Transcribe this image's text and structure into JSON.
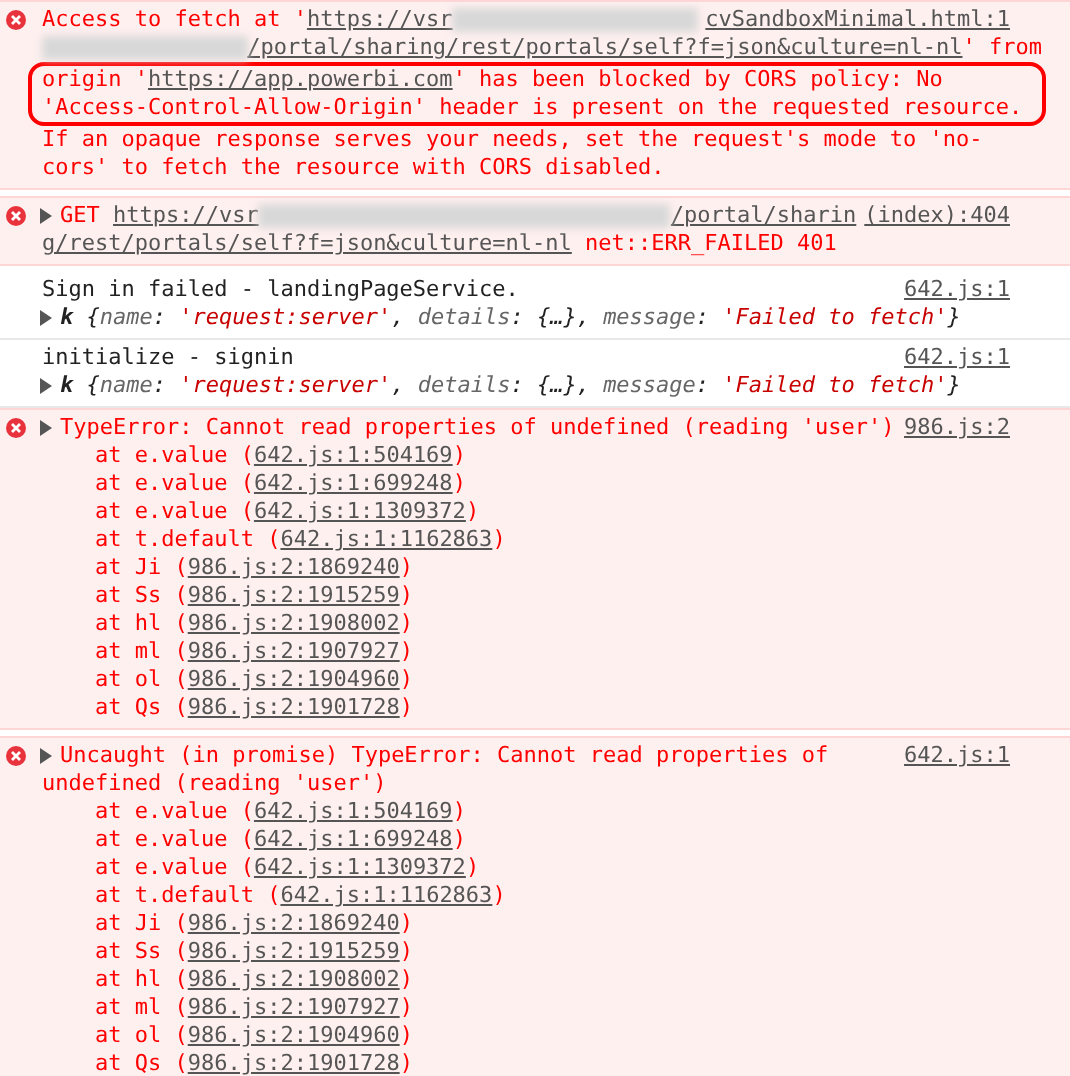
{
  "messages": [
    {
      "kind": "error",
      "source": "cvSandboxMinimal.html:1",
      "lines": [
        {
          "circled": false,
          "segments": [
            {
              "kind": "plain",
              "text": "Access to fetch at '"
            },
            {
              "kind": "link",
              "text": "https://vsr"
            },
            {
              "kind": "redacted"
            }
          ]
        },
        {
          "circled": false,
          "segments": [
            {
              "kind": "redacted"
            },
            {
              "kind": "link",
              "text": "/portal/sharing/rest/portals/self?f=json&culture=nl-nl"
            },
            {
              "kind": "plain",
              "text": "' from"
            }
          ]
        },
        {
          "circled": true,
          "segments": [
            {
              "kind": "plain",
              "text": "origin '"
            },
            {
              "kind": "link",
              "text": "https://app.powerbi.com"
            },
            {
              "kind": "plain",
              "text": "' has been blocked by CORS policy: No"
            }
          ]
        },
        {
          "circled": true,
          "segments": [
            {
              "kind": "plain",
              "text": "'Access-Control-Allow-Origin' header is present on the requested resource."
            }
          ]
        },
        {
          "circled": false,
          "segments": [
            {
              "kind": "plain",
              "text": "If an opaque response serves your needs, set the request's mode to 'no-"
            }
          ]
        },
        {
          "circled": false,
          "segments": [
            {
              "kind": "plain",
              "text": "cors' to fetch the resource with CORS disabled."
            }
          ]
        }
      ]
    },
    {
      "kind": "error",
      "source": "(index):404",
      "lines": [
        {
          "circled": false,
          "expanded": false,
          "segments": [
            {
              "kind": "plain",
              "text": "GET "
            },
            {
              "kind": "link",
              "text": "https://vsr"
            },
            {
              "kind": "redacted"
            },
            {
              "kind": "link",
              "text": "/portal/sharin"
            }
          ]
        },
        {
          "circled": false,
          "segments": [
            {
              "kind": "link",
              "text": "g/rest/portals/self?f=json&culture=nl-nl"
            },
            {
              "kind": "plain",
              "text": " net::ERR_FAILED 401"
            }
          ]
        }
      ]
    },
    {
      "kind": "log",
      "source": "642.js:1",
      "lines": [
        {
          "circled": false,
          "segments": [
            {
              "kind": "plain",
              "text": "Sign in failed - landingPageService."
            }
          ]
        },
        {
          "circled": false,
          "expanded": false,
          "segments": [
            {
              "kind": "class",
              "text": "k"
            },
            {
              "kind": "punct",
              "text": " {"
            },
            {
              "kind": "key",
              "text": "name"
            },
            {
              "kind": "punct",
              "text": ": "
            },
            {
              "kind": "string",
              "text": "'request:server'"
            },
            {
              "kind": "punct",
              "text": ", "
            },
            {
              "kind": "key",
              "text": "details"
            },
            {
              "kind": "punct",
              "text": ": {…}, "
            },
            {
              "kind": "key",
              "text": "message"
            },
            {
              "kind": "punct",
              "text": ": "
            },
            {
              "kind": "string",
              "text": "'Failed to fetch'"
            },
            {
              "kind": "punct",
              "text": "}"
            }
          ]
        }
      ]
    },
    {
      "kind": "log",
      "source": "642.js:1",
      "lines": [
        {
          "circled": false,
          "segments": [
            {
              "kind": "plain",
              "text": "initialize - signin"
            }
          ]
        },
        {
          "circled": false,
          "expanded": false,
          "segments": [
            {
              "kind": "class",
              "text": "k"
            },
            {
              "kind": "punct",
              "text": " {"
            },
            {
              "kind": "key",
              "text": "name"
            },
            {
              "kind": "punct",
              "text": ": "
            },
            {
              "kind": "string",
              "text": "'request:server'"
            },
            {
              "kind": "punct",
              "text": ", "
            },
            {
              "kind": "key",
              "text": "details"
            },
            {
              "kind": "punct",
              "text": ": {…}, "
            },
            {
              "kind": "key",
              "text": "message"
            },
            {
              "kind": "punct",
              "text": ": "
            },
            {
              "kind": "string",
              "text": "'Failed to fetch'"
            },
            {
              "kind": "punct",
              "text": "}"
            }
          ]
        }
      ]
    },
    {
      "kind": "error",
      "source": "986.js:2",
      "lines": [
        {
          "circled": false,
          "expanded": false,
          "segments": [
            {
              "kind": "plain",
              "text": "TypeError: Cannot read properties of undefined (reading 'user')"
            }
          ]
        },
        {
          "circled": false,
          "segments": [
            {
              "kind": "plain",
              "text": "    at e.value ("
            },
            {
              "kind": "link",
              "text": "642.js:1:504169"
            },
            {
              "kind": "plain",
              "text": ")"
            }
          ]
        },
        {
          "circled": false,
          "segments": [
            {
              "kind": "plain",
              "text": "    at e.value ("
            },
            {
              "kind": "link",
              "text": "642.js:1:699248"
            },
            {
              "kind": "plain",
              "text": ")"
            }
          ]
        },
        {
          "circled": false,
          "segments": [
            {
              "kind": "plain",
              "text": "    at e.value ("
            },
            {
              "kind": "link",
              "text": "642.js:1:1309372"
            },
            {
              "kind": "plain",
              "text": ")"
            }
          ]
        },
        {
          "circled": false,
          "segments": [
            {
              "kind": "plain",
              "text": "    at t.default ("
            },
            {
              "kind": "link",
              "text": "642.js:1:1162863"
            },
            {
              "kind": "plain",
              "text": ")"
            }
          ]
        },
        {
          "circled": false,
          "segments": [
            {
              "kind": "plain",
              "text": "    at Ji ("
            },
            {
              "kind": "link",
              "text": "986.js:2:1869240"
            },
            {
              "kind": "plain",
              "text": ")"
            }
          ]
        },
        {
          "circled": false,
          "segments": [
            {
              "kind": "plain",
              "text": "    at Ss ("
            },
            {
              "kind": "link",
              "text": "986.js:2:1915259"
            },
            {
              "kind": "plain",
              "text": ")"
            }
          ]
        },
        {
          "circled": false,
          "segments": [
            {
              "kind": "plain",
              "text": "    at hl ("
            },
            {
              "kind": "link",
              "text": "986.js:2:1908002"
            },
            {
              "kind": "plain",
              "text": ")"
            }
          ]
        },
        {
          "circled": false,
          "segments": [
            {
              "kind": "plain",
              "text": "    at ml ("
            },
            {
              "kind": "link",
              "text": "986.js:2:1907927"
            },
            {
              "kind": "plain",
              "text": ")"
            }
          ]
        },
        {
          "circled": false,
          "segments": [
            {
              "kind": "plain",
              "text": "    at ol ("
            },
            {
              "kind": "link",
              "text": "986.js:2:1904960"
            },
            {
              "kind": "plain",
              "text": ")"
            }
          ]
        },
        {
          "circled": false,
          "segments": [
            {
              "kind": "plain",
              "text": "    at Qs ("
            },
            {
              "kind": "link",
              "text": "986.js:2:1901728"
            },
            {
              "kind": "plain",
              "text": ")"
            }
          ]
        }
      ]
    },
    {
      "kind": "error",
      "source": "642.js:1",
      "lines": [
        {
          "circled": false,
          "expanded": false,
          "segments": [
            {
              "kind": "plain",
              "text": "Uncaught (in promise) TypeError: Cannot read properties of"
            }
          ]
        },
        {
          "circled": false,
          "segments": [
            {
              "kind": "plain",
              "text": "undefined (reading 'user')"
            }
          ]
        },
        {
          "circled": false,
          "segments": [
            {
              "kind": "plain",
              "text": "    at e.value ("
            },
            {
              "kind": "link",
              "text": "642.js:1:504169"
            },
            {
              "kind": "plain",
              "text": ")"
            }
          ]
        },
        {
          "circled": false,
          "segments": [
            {
              "kind": "plain",
              "text": "    at e.value ("
            },
            {
              "kind": "link",
              "text": "642.js:1:699248"
            },
            {
              "kind": "plain",
              "text": ")"
            }
          ]
        },
        {
          "circled": false,
          "segments": [
            {
              "kind": "plain",
              "text": "    at e.value ("
            },
            {
              "kind": "link",
              "text": "642.js:1:1309372"
            },
            {
              "kind": "plain",
              "text": ")"
            }
          ]
        },
        {
          "circled": false,
          "segments": [
            {
              "kind": "plain",
              "text": "    at t.default ("
            },
            {
              "kind": "link",
              "text": "642.js:1:1162863"
            },
            {
              "kind": "plain",
              "text": ")"
            }
          ]
        },
        {
          "circled": false,
          "segments": [
            {
              "kind": "plain",
              "text": "    at Ji ("
            },
            {
              "kind": "link",
              "text": "986.js:2:1869240"
            },
            {
              "kind": "plain",
              "text": ")"
            }
          ]
        },
        {
          "circled": false,
          "segments": [
            {
              "kind": "plain",
              "text": "    at Ss ("
            },
            {
              "kind": "link",
              "text": "986.js:2:1915259"
            },
            {
              "kind": "plain",
              "text": ")"
            }
          ]
        },
        {
          "circled": false,
          "segments": [
            {
              "kind": "plain",
              "text": "    at hl ("
            },
            {
              "kind": "link",
              "text": "986.js:2:1908002"
            },
            {
              "kind": "plain",
              "text": ")"
            }
          ]
        },
        {
          "circled": false,
          "segments": [
            {
              "kind": "plain",
              "text": "    at ml ("
            },
            {
              "kind": "link",
              "text": "986.js:2:1907927"
            },
            {
              "kind": "plain",
              "text": ")"
            }
          ]
        },
        {
          "circled": false,
          "segments": [
            {
              "kind": "plain",
              "text": "    at ol ("
            },
            {
              "kind": "link",
              "text": "986.js:2:1904960"
            },
            {
              "kind": "plain",
              "text": ")"
            }
          ]
        },
        {
          "circled": false,
          "segments": [
            {
              "kind": "plain",
              "text": "    at Qs ("
            },
            {
              "kind": "link",
              "text": "986.js:2:1901728"
            },
            {
              "kind": "plain",
              "text": ")"
            }
          ]
        }
      ]
    }
  ]
}
